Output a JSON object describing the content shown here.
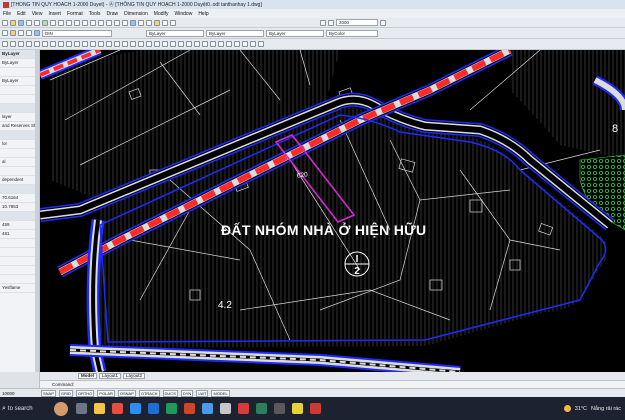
{
  "window": {
    "title": "[THONG TIN QUY HOACH 1-2000 Duyet) - Ⓐ [THÔNG TIN QUY HOẠCH 1-2000 Duyệt0..odt tanthanhay 1.dwg]"
  },
  "menu": [
    "File",
    "Edit",
    "View",
    "Insert",
    "Format",
    "Tools",
    "Draw",
    "Dimension",
    "Modify",
    "Window",
    "Help"
  ],
  "toolbar": {
    "scale_value": "2000",
    "style_value": "DIN",
    "layer_value": "ByLayer",
    "linetype_value": "ByLayer",
    "lineweight_value": "ByLayer",
    "plotstyle_value": "ByColor"
  },
  "palette": {
    "rows": [
      "ByLayer",
      "ByLayer",
      "",
      "ByLayer",
      "",
      "",
      "",
      "layer",
      "and Reserves Sh...",
      "",
      "lor",
      "",
      "al",
      "",
      "dependent",
      "",
      "70.6164",
      "10.7853",
      "",
      "459",
      "481",
      "",
      "",
      "",
      "",
      "",
      "Yesflame"
    ]
  },
  "drawing": {
    "zone_title": "ĐẤT NHÓM NHÀ Ở HIỆN HỮU",
    "lot_id_top": "I",
    "lot_id_bottom": "2",
    "area_label": "4.2",
    "lot_number": "620",
    "corner_label": "8"
  },
  "tabs": [
    "Model",
    "Layout1",
    "Layout2"
  ],
  "cmdline": "Command:",
  "status": {
    "coords": "10000",
    "buttons": [
      "SNAP",
      "GRID",
      "ORTHO",
      "POLAR",
      "OSNAP",
      "OTRACK",
      "DUCS",
      "DYN",
      "LWT",
      "MODEL"
    ]
  },
  "taskbar": {
    "search": "to search",
    "temperature": "31°C",
    "weather_text": "Nắng rải rác"
  },
  "colors": {
    "road_outline": "#1d2bff",
    "road_fill": "#dcdcdc",
    "road_dash": "#ff2a2a",
    "lot_outline": "#d428d4",
    "hatch": "#6a6a6a",
    "green_zone": "#2ecc40"
  }
}
